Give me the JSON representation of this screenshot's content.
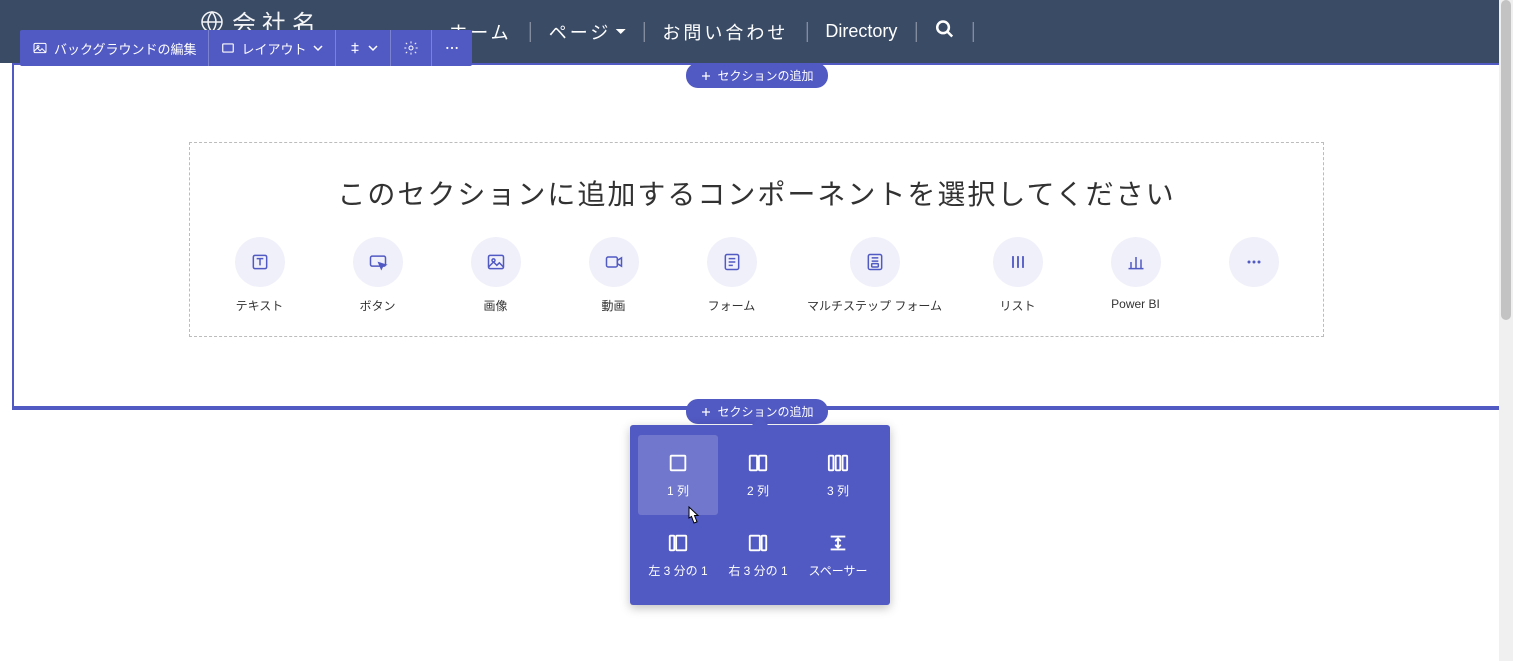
{
  "company_name": "会社名",
  "nav": {
    "home": "ホーム",
    "pages": "ページ",
    "contact": "お問い合わせ",
    "directory": "Directory"
  },
  "toolbar": {
    "background_edit": "バックグラウンドの編集",
    "layout": "レイアウト"
  },
  "add_section_label": "セクションの追加",
  "picker_title": "このセクションに追加するコンポーネントを選択してください",
  "components": {
    "text": "テキスト",
    "button": "ボタン",
    "image": "画像",
    "video": "動画",
    "form": "フォーム",
    "multistep_form": "マルチステップ フォーム",
    "list": "リスト",
    "powerbi": "Power BI"
  },
  "layouts": {
    "col1": "1 列",
    "col2": "2 列",
    "col3": "3 列",
    "left_third": "左 3 分の 1",
    "right_third": "右 3 分の 1",
    "spacer": "スペーサー"
  }
}
